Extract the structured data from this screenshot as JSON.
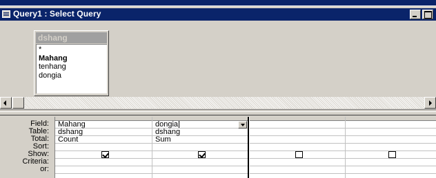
{
  "window": {
    "title": "Query1 : Select Query"
  },
  "table_box": {
    "name": "dshang",
    "fields": [
      "*",
      "Mahang",
      "tenhang",
      "dongia"
    ],
    "bold_field_index": 1
  },
  "grid": {
    "row_labels": [
      "Field:",
      "Table:",
      "Total:",
      "Sort:",
      "Show:",
      "Criteria:",
      "or:"
    ],
    "columns": [
      {
        "field": "Mahang",
        "table": "dshang",
        "total": "Count",
        "sort": "",
        "show": true,
        "criteria": "",
        "or": ""
      },
      {
        "field": "dongia",
        "table": "dshang",
        "total": "Sum",
        "sort": "",
        "show": true,
        "criteria": "",
        "or": ""
      },
      {
        "field": "",
        "table": "",
        "total": "",
        "sort": "",
        "show": false,
        "criteria": "",
        "or": ""
      },
      {
        "field": "",
        "table": "",
        "total": "",
        "sort": "",
        "show": false,
        "criteria": "",
        "or": ""
      }
    ]
  },
  "icons": {
    "app": "query-icon",
    "minimize": "minimize-icon",
    "maximize": "maximize-icon",
    "scroll_left": "arrow-left-icon",
    "scroll_right": "arrow-right-icon",
    "dropdown": "chevron-down-icon"
  },
  "colors": {
    "titlebar": "#0a246a",
    "face": "#d4d0c8",
    "table_title_inactive": "#a0a0a0"
  }
}
